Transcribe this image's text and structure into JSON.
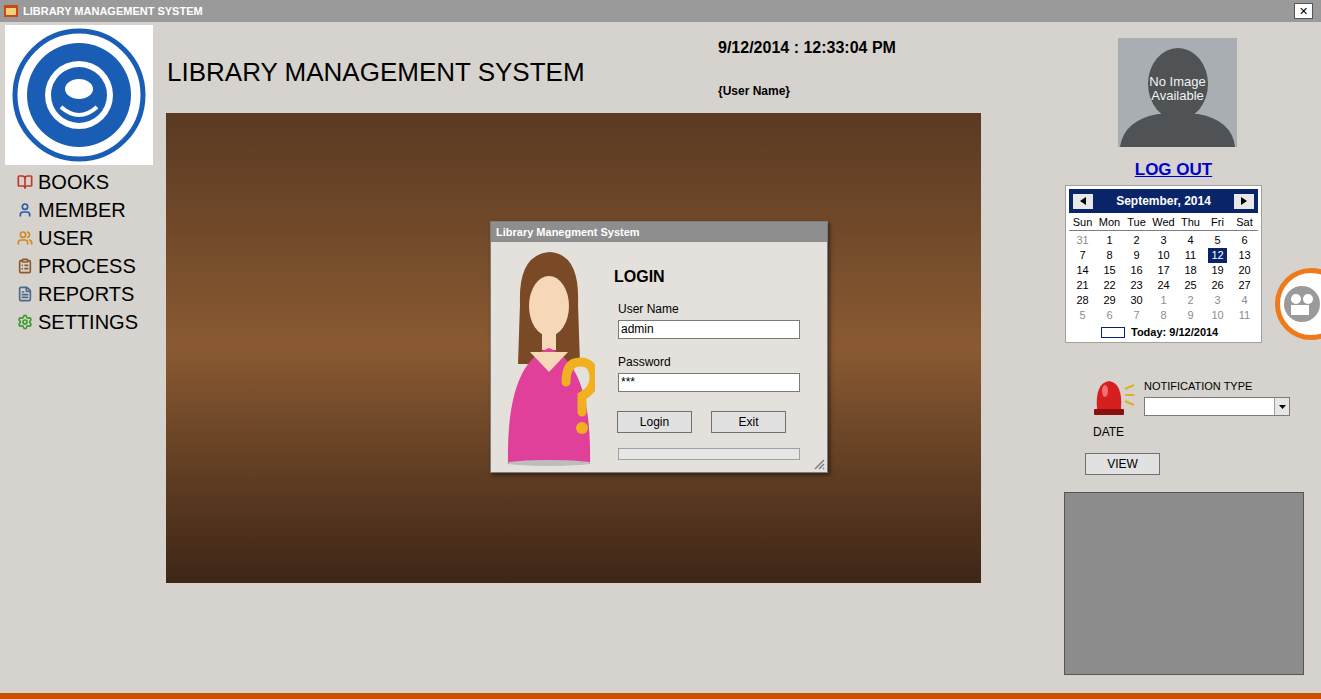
{
  "window": {
    "title": "LIBRARY MANAGEMENT SYSTEM",
    "close": "✕"
  },
  "nav": [
    {
      "label": "BOOKS"
    },
    {
      "label": "MEMBER"
    },
    {
      "label": "USER"
    },
    {
      "label": "PROCESS"
    },
    {
      "label": "REPORTS"
    },
    {
      "label": "SETTINGS"
    }
  ],
  "header": {
    "title": "LIBRARY MANAGEMENT SYSTEM",
    "datetime": "9/12/2014 : 12:33:04 PM",
    "user": "{User Name}"
  },
  "login": {
    "title": "Library Manegment System",
    "heading": "LOGIN",
    "fields": [
      {
        "label": "User Name",
        "value": "admin"
      },
      {
        "label": "Password",
        "value": "***"
      }
    ],
    "buttons": [
      "Login",
      "Exit"
    ],
    "progress": {
      "level": 0
    }
  },
  "profile": {
    "image_text": "No Image Available",
    "logout": "LOG OUT"
  },
  "calendar": {
    "month": "September, 2014",
    "weekdays": [
      "Sun",
      "Mon",
      "Tue",
      "Wed",
      "Thu",
      "Fri",
      "Sat"
    ],
    "weeks": [
      [
        {
          "day": "31",
          "other": true,
          "selected": false
        },
        {
          "day": "1",
          "other": false,
          "selected": false
        },
        {
          "day": "2",
          "other": false,
          "selected": false
        },
        {
          "day": "3",
          "other": false,
          "selected": false
        },
        {
          "day": "4",
          "other": false,
          "selected": false
        },
        {
          "day": "5",
          "other": false,
          "selected": false
        },
        {
          "day": "6",
          "other": false,
          "selected": false
        }
      ],
      [
        {
          "day": "7",
          "other": false,
          "selected": false
        },
        {
          "day": "8",
          "other": false,
          "selected": false
        },
        {
          "day": "9",
          "other": false,
          "selected": false
        },
        {
          "day": "10",
          "other": false,
          "selected": false
        },
        {
          "day": "11",
          "other": false,
          "selected": false
        },
        {
          "day": "12",
          "other": false,
          "selected": true
        },
        {
          "day": "13",
          "other": false,
          "selected": false
        }
      ],
      [
        {
          "day": "14",
          "other": false,
          "selected": false
        },
        {
          "day": "15",
          "other": false,
          "selected": false
        },
        {
          "day": "16",
          "other": false,
          "selected": false
        },
        {
          "day": "17",
          "other": false,
          "selected": false
        },
        {
          "day": "18",
          "other": false,
          "selected": false
        },
        {
          "day": "19",
          "other": false,
          "selected": false
        },
        {
          "day": "20",
          "other": false,
          "selected": false
        }
      ],
      [
        {
          "day": "21",
          "other": false,
          "selected": false
        },
        {
          "day": "22",
          "other": false,
          "selected": false
        },
        {
          "day": "23",
          "other": false,
          "selected": false
        },
        {
          "day": "24",
          "other": false,
          "selected": false
        },
        {
          "day": "25",
          "other": false,
          "selected": false
        },
        {
          "day": "26",
          "other": false,
          "selected": false
        },
        {
          "day": "27",
          "other": false,
          "selected": false
        }
      ],
      [
        {
          "day": "28",
          "other": false,
          "selected": false
        },
        {
          "day": "29",
          "other": false,
          "selected": false
        },
        {
          "day": "30",
          "other": false,
          "selected": false
        },
        {
          "day": "1",
          "other": true,
          "selected": false
        },
        {
          "day": "2",
          "other": true,
          "selected": false
        },
        {
          "day": "3",
          "other": true,
          "selected": false
        },
        {
          "day": "4",
          "other": true,
          "selected": false
        }
      ],
      [
        {
          "day": "5",
          "other": true,
          "selected": false
        },
        {
          "day": "6",
          "other": true,
          "selected": false
        },
        {
          "day": "7",
          "other": true,
          "selected": false
        },
        {
          "day": "8",
          "other": true,
          "selected": false
        },
        {
          "day": "9",
          "other": true,
          "selected": false
        },
        {
          "day": "10",
          "other": true,
          "selected": false
        },
        {
          "day": "11",
          "other": true,
          "selected": false
        }
      ]
    ],
    "today": "Today: 9/12/2014"
  },
  "notifications": {
    "type_label": "NOTIFICATION TYPE",
    "type_value": "",
    "date_label": "DATE",
    "button": "VIEW"
  }
}
